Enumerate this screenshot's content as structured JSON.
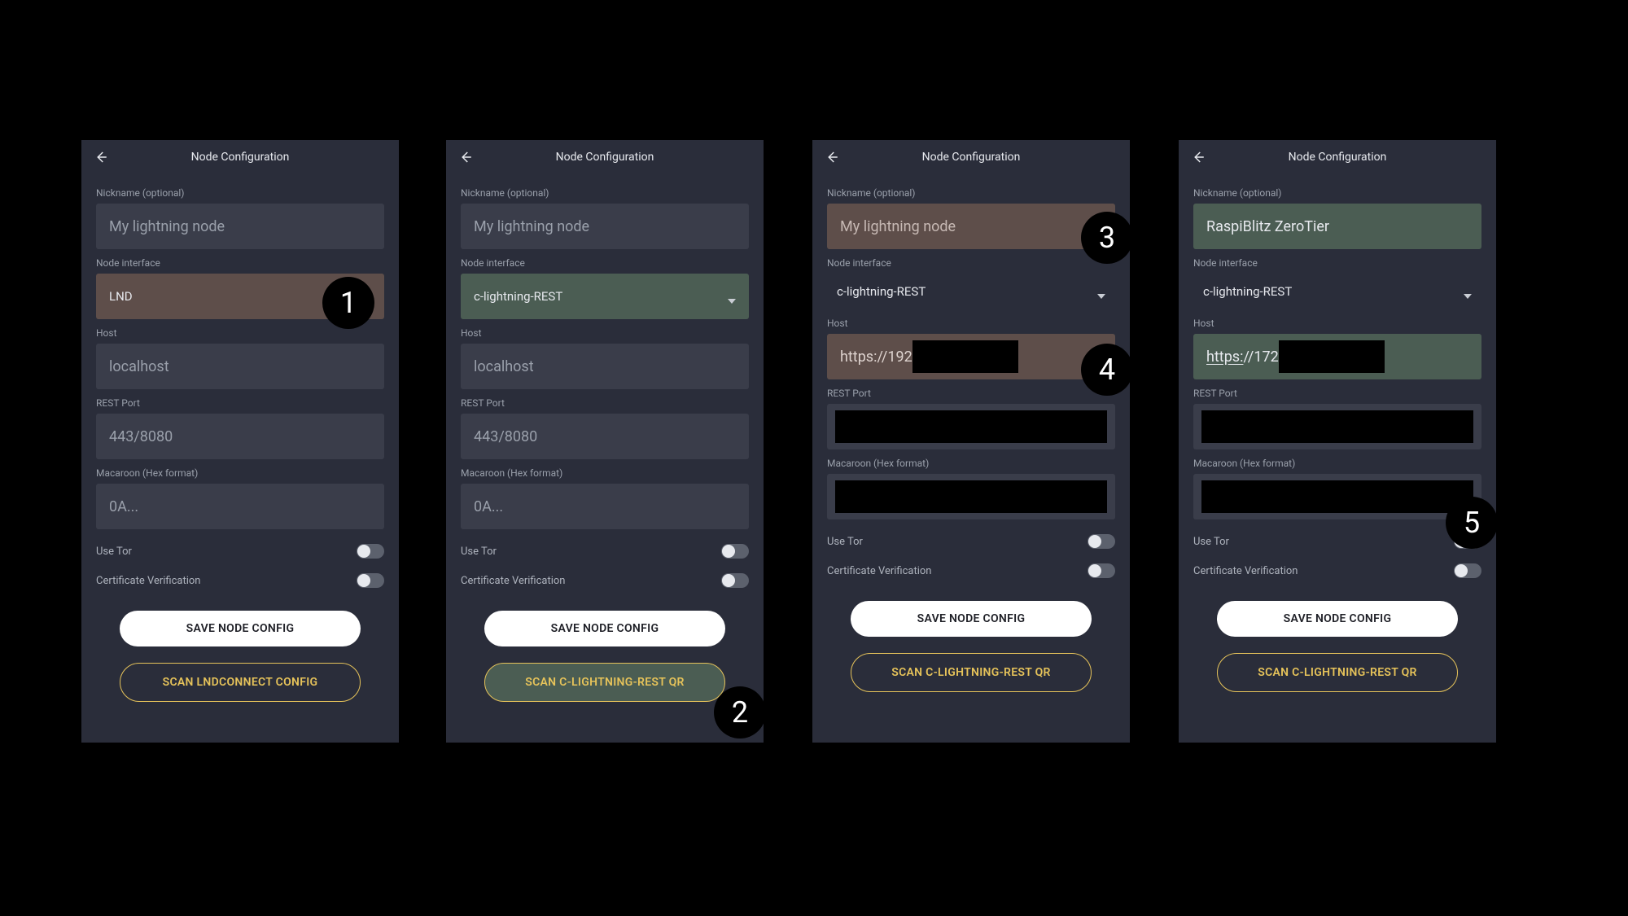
{
  "header": {
    "title": "Node Configuration"
  },
  "labels": {
    "nickname": "Nickname (optional)",
    "node_interface": "Node interface",
    "host": "Host",
    "rest_port": "REST Port",
    "macaroon": "Macaroon (Hex format)",
    "use_tor": "Use Tor",
    "cert_verify": "Certificate Verification"
  },
  "placeholders": {
    "nickname": "My lightning node",
    "host": "localhost",
    "rest_port": "443/8080",
    "macaroon": "0A..."
  },
  "buttons": {
    "save": "SAVE NODE CONFIG",
    "scan_lnd": "SCAN LNDCONNECT CONFIG",
    "scan_cl": "SCAN C-LIGHTNING-REST QR"
  },
  "panels": {
    "p1": {
      "interface": "LND"
    },
    "p2": {
      "interface": "c-lightning-REST"
    },
    "p3": {
      "interface": "c-lightning-REST",
      "host_prefix": "https://192"
    },
    "p4": {
      "interface": "c-lightning-REST",
      "nickname": "RaspiBlitz ZeroTier",
      "host_prefix_a": "https:",
      "host_prefix_b": "//172"
    }
  },
  "badges": {
    "b1": "1",
    "b2": "2",
    "b3": "3",
    "b4": "4",
    "b5": "5"
  }
}
